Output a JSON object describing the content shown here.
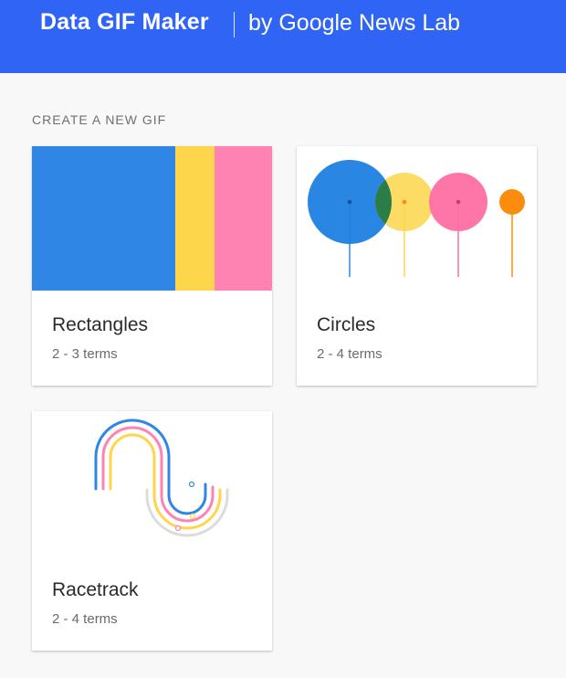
{
  "header": {
    "brand": "Data GIF Maker",
    "byline": "by Google News Lab",
    "background_color": "#2f64f4"
  },
  "section_label": "CREATE A NEW GIF",
  "cards": [
    {
      "title": "Rectangles",
      "subtitle": "2 - 3 terms",
      "thumbnail": "rectangles-illustration",
      "colors": [
        "#2f86e5",
        "#fdd64b",
        "#fe83b2"
      ]
    },
    {
      "title": "Circles",
      "subtitle": "2 - 4 terms",
      "thumbnail": "circles-illustration",
      "colors": [
        "#1e7fe0",
        "#fdd64b",
        "#fe6fa3",
        "#fb8c0c"
      ]
    },
    {
      "title": "Racetrack",
      "subtitle": "2 - 4 terms",
      "thumbnail": "racetrack-illustration",
      "colors": [
        "#2f86e5",
        "#fe83b2",
        "#fdd64b",
        "#dcdcdc"
      ]
    }
  ]
}
